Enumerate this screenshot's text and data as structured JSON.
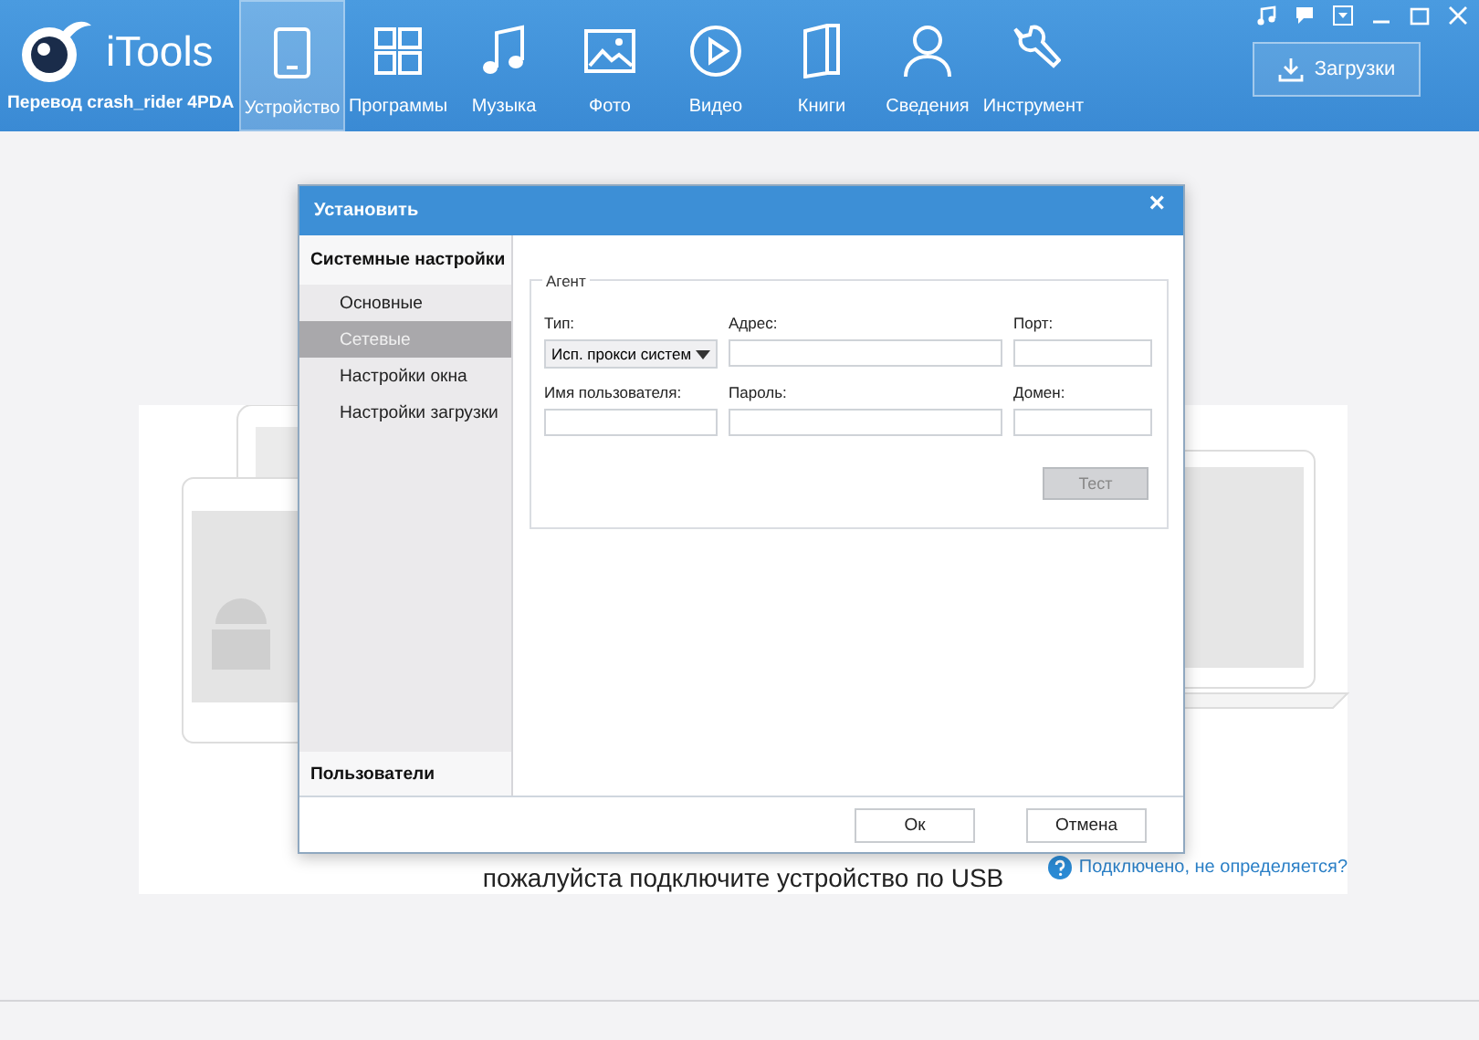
{
  "app": {
    "logo": "iTools",
    "credit": "Перевод crash_rider 4PDA"
  },
  "nav": [
    {
      "label": "Устройство",
      "kind": "tablet",
      "selected": true
    },
    {
      "label": "Программы",
      "kind": "apps",
      "selected": false
    },
    {
      "label": "Музыка",
      "kind": "music",
      "selected": false
    },
    {
      "label": "Фото",
      "kind": "photo",
      "selected": false
    },
    {
      "label": "Видео",
      "kind": "video",
      "selected": false
    },
    {
      "label": "Книги",
      "kind": "book",
      "selected": false
    },
    {
      "label": "Сведения",
      "kind": "person",
      "selected": false
    },
    {
      "label": "Инструмент",
      "kind": "wrench",
      "selected": false
    }
  ],
  "downloads_button": "Загрузки",
  "stage": {
    "message": "пожалуйста подключите устройство по USB",
    "help_link": "Подключено, не определяется?"
  },
  "dialog": {
    "title": "Установить",
    "close": "×",
    "sidebar": {
      "section": "Системные настройки",
      "items": [
        {
          "label": "Основные",
          "selected": false
        },
        {
          "label": "Сетевые",
          "selected": true
        },
        {
          "label": "Настройки окна",
          "selected": false
        },
        {
          "label": "Настройки загрузки",
          "selected": false
        }
      ],
      "footer": "Пользователи"
    },
    "group": {
      "title": "Агент",
      "fields": [
        {
          "label": "Тип:",
          "kind": "select",
          "value": "Исп. прокси систем"
        },
        {
          "label": "Адрес:",
          "kind": "text"
        },
        {
          "label": "Порт:",
          "kind": "text"
        },
        {
          "label": "Имя пользователя:",
          "kind": "text"
        },
        {
          "label": "Пароль:",
          "kind": "password"
        },
        {
          "label": "Домен:",
          "kind": "text"
        }
      ]
    },
    "test_button": {
      "label": "Тест",
      "disabled": true
    },
    "buttons": [
      "Ок",
      "Отмена"
    ]
  }
}
